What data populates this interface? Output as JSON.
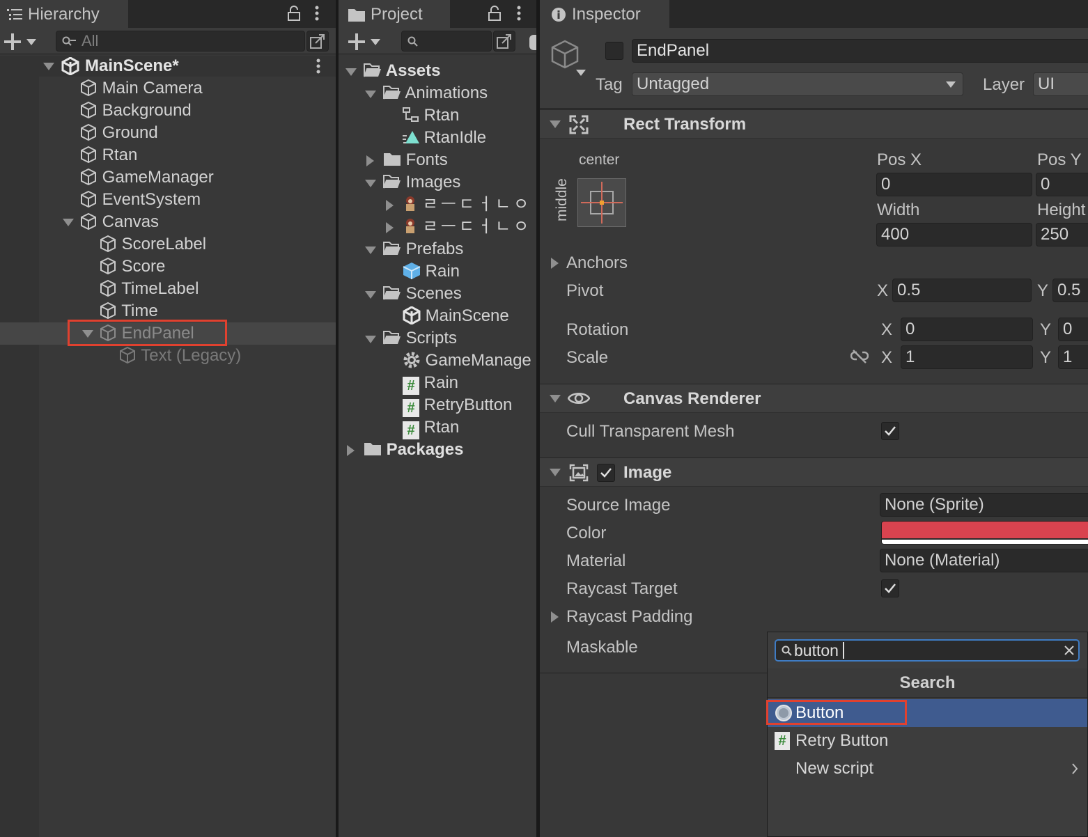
{
  "hierarchy": {
    "tab_label": "Hierarchy",
    "search_placeholder": "All",
    "scene_name": "MainScene*",
    "items": [
      "Main Camera",
      "Background",
      "Ground",
      "Rtan",
      "GameManager",
      "EventSystem",
      "Canvas",
      "ScoreLabel",
      "Score",
      "TimeLabel",
      "Time",
      "EndPanel",
      "Text (Legacy)"
    ]
  },
  "project": {
    "tab_label": "Project",
    "items": [
      "Assets",
      "Animations",
      "Rtan",
      "RtanIdle",
      "Fonts",
      "Images",
      "ㄹㅡㄷㅓㄴㅇㅣ",
      "ㄹㅡㄷㅓㄴㅇㅣ",
      "Prefabs",
      "Rain",
      "Scenes",
      "MainScene",
      "Scripts",
      "GameManage",
      "Rain",
      "RetryButton",
      "Rtan",
      "Packages"
    ]
  },
  "inspector": {
    "tab_label": "Inspector",
    "object_name": "EndPanel",
    "tag_label": "Tag",
    "tag_value": "Untagged",
    "layer_label": "Layer",
    "layer_value": "UI",
    "rect_transform": {
      "title": "Rect Transform",
      "anchor_h": "center",
      "anchor_v": "middle",
      "pos_x_label": "Pos X",
      "pos_y_label": "Pos Y",
      "pos_x": "0",
      "pos_y": "0",
      "width_label": "Width",
      "height_label": "Height",
      "width": "400",
      "height": "250",
      "anchors_label": "Anchors",
      "pivot_label": "Pivot",
      "pivot_x": "0.5",
      "pivot_y": "0.5",
      "rotation_label": "Rotation",
      "rotation_x": "0",
      "rotation_y": "0",
      "scale_label": "Scale",
      "scale_x": "1",
      "scale_y": "1",
      "x": "X",
      "y": "Y"
    },
    "canvas_renderer": {
      "title": "Canvas Renderer",
      "cull_label": "Cull Transparent Mesh"
    },
    "image": {
      "title": "Image",
      "source_label": "Source Image",
      "source_value": "None (Sprite)",
      "color_label": "Color",
      "color_value": "#d9434f",
      "material_label": "Material",
      "material_value": "None (Material)",
      "raycast_label": "Raycast Target",
      "raycast_padding_label": "Raycast Padding",
      "maskable_label": "Maskable"
    }
  },
  "add_component_popup": {
    "search_value": "button",
    "header": "Search",
    "results": [
      "Button",
      "Retry Button",
      "New script"
    ]
  },
  "colors": {
    "selection": "#2c5d87",
    "popup_selection": "#3f5b8f",
    "highlight_box": "#e0412f"
  }
}
